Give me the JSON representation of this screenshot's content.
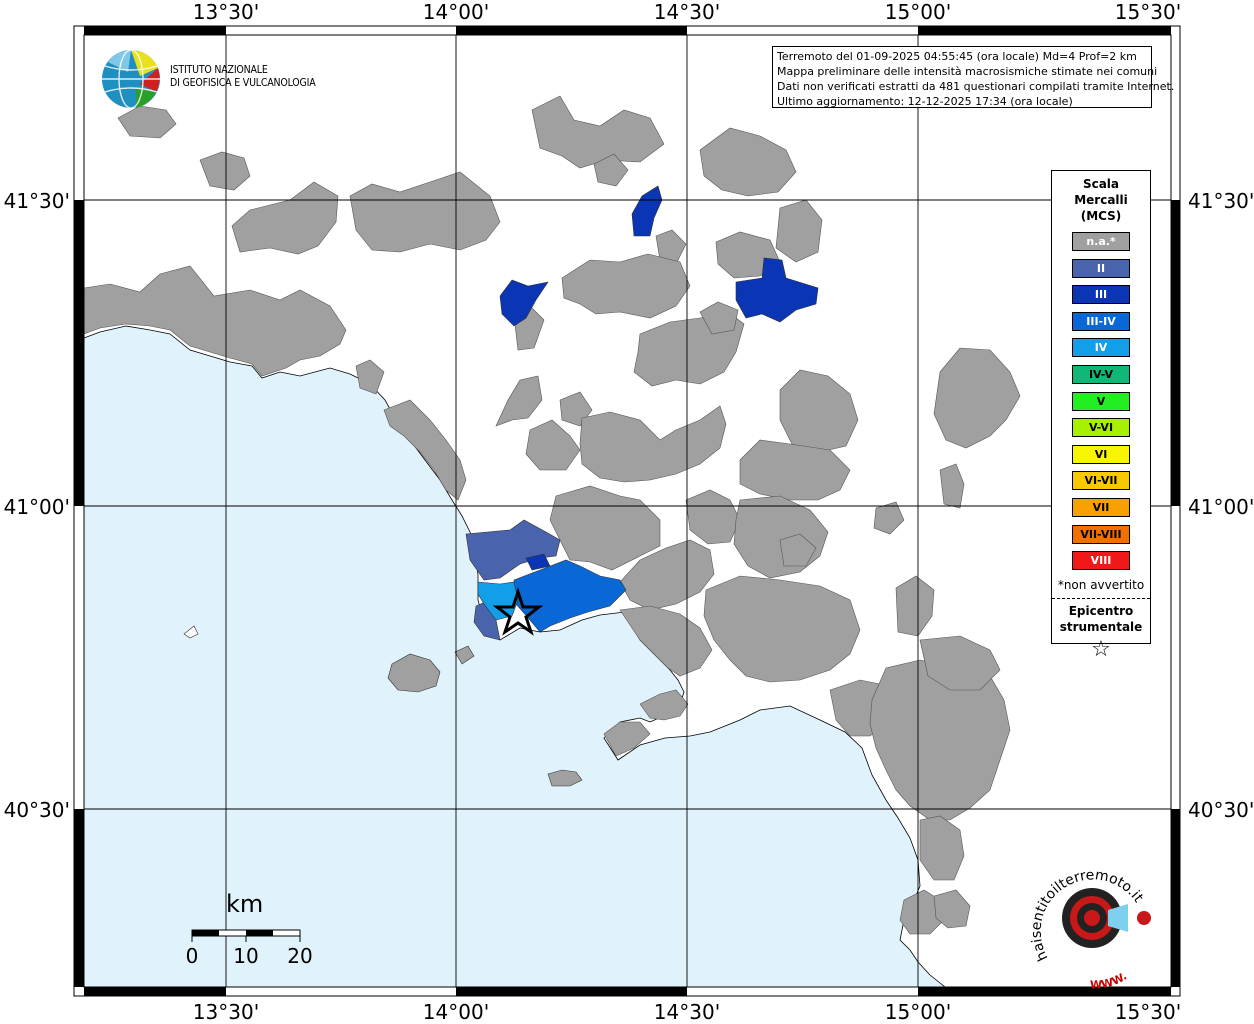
{
  "map": {
    "longitude_ticks": [
      "13°30'",
      "14°00'",
      "14°30'",
      "15°00'",
      "15°30'"
    ],
    "latitude_ticks": [
      "41°30'",
      "41°00'",
      "40°30'"
    ],
    "colors": {
      "sea": "#e0f2fc",
      "land": "#ffffff",
      "municipality_na": "#a0a0a0",
      "frame": "#000000"
    }
  },
  "info": {
    "line1": "Terremoto del 01-09-2025 04:55:45 (ora locale) Md=4 Prof=2 km",
    "line2": "Mappa preliminare delle intensità macrosismiche stimate nei comuni",
    "line3": "Dati non verificati estratti da 481 questionari compilati tramite Internet.",
    "line4": "Ultimo aggiornamento: 12-12-2025 17:34 (ora locale)"
  },
  "logo": {
    "line1": "ISTITUTO NAZIONALE",
    "line2": "DI GEOFISICA E VULCANOLOGIA"
  },
  "legend": {
    "title1": "Scala",
    "title2": "Mercalli",
    "title3": "(MCS)",
    "classes": [
      {
        "label": "n.a.*",
        "color": "#a0a0a0"
      },
      {
        "label": "II",
        "color": "#4a63ad"
      },
      {
        "label": "III",
        "color": "#0a35b4"
      },
      {
        "label": "III-IV",
        "color": "#0a68d6"
      },
      {
        "label": "IV",
        "color": "#129ee8"
      },
      {
        "label": "IV-V",
        "color": "#10b878"
      },
      {
        "label": "V",
        "color": "#22ee22"
      },
      {
        "label": "V-VI",
        "color": "#a6f000"
      },
      {
        "label": "VI",
        "color": "#f8f500"
      },
      {
        "label": "VI-VII",
        "color": "#f8c800"
      },
      {
        "label": "VII",
        "color": "#f8a000"
      },
      {
        "label": "VII-VIII",
        "color": "#f07000"
      },
      {
        "label": "VIII",
        "color": "#f01818"
      }
    ],
    "note": "*non avvertito",
    "epicenter1": "Epicentro",
    "epicenter2": "strumentale",
    "star": "☆"
  },
  "scalebar": {
    "unit": "km",
    "labels": [
      "0",
      "10",
      "20"
    ]
  },
  "brand": {
    "outer_text": "haisentitoilterremoto.it",
    "inner_text": "WWW."
  }
}
